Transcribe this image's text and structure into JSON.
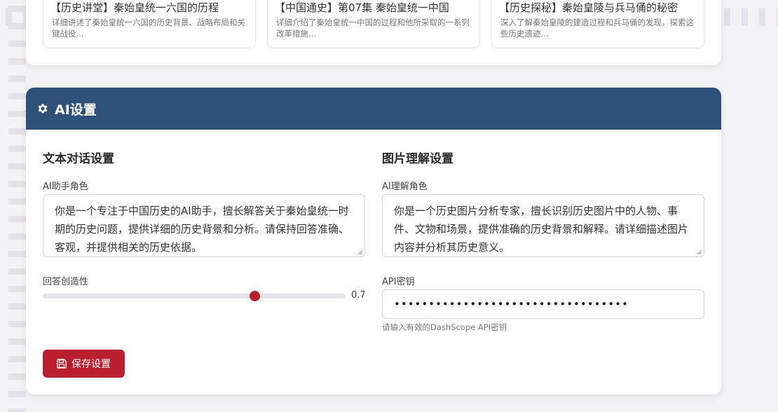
{
  "videos": [
    {
      "title": "【历史讲堂】秦始皇统一六国的历程",
      "desc": "详细讲述了秦始皇统一六国的历史背景、战略布局和关键战役..."
    },
    {
      "title": "【中国通史】第07集 秦始皇统一中国",
      "desc": "详细介绍了秦始皇统一中国的过程和他所采取的一系列改革措施..."
    },
    {
      "title": "【历史探秘】秦始皇陵与兵马俑的秘密",
      "desc": "深入了解秦始皇陵的建造过程和兵马俑的发现，探索这些历史遗迹..."
    }
  ],
  "settings": {
    "header_title": "AI设置",
    "header_icon": "gear-icon",
    "text": {
      "section_title": "文本对话设置",
      "role_label": "AI助手角色",
      "role_value": "你是一个专注于中国历史的AI助手，擅长解答关于秦始皇统一时期的历史问题，提供详细的历史背景和分析。请保持回答准确、客观，并提供相关的历史依据。",
      "creativity_label": "回答创造性",
      "creativity_value": "0.7",
      "creativity_fraction": 0.7
    },
    "image": {
      "section_title": "图片理解设置",
      "role_label": "AI理解角色",
      "role_value": "你是一个历史图片分析专家，擅长识别历史图片中的人物、事件、文物和场景，提供准确的历史背景和解释。请详细描述图片内容并分析其历史意义。",
      "api_label": "API密钥",
      "api_value": "••••••••••••••••••••••••••••••••••",
      "api_hint": "请输入有效的DashScope API密钥"
    },
    "save_label": "保存设置",
    "save_icon": "floppy-disk-icon"
  },
  "colors": {
    "header_bg": "#2f5078",
    "accent": "#b8202f"
  }
}
